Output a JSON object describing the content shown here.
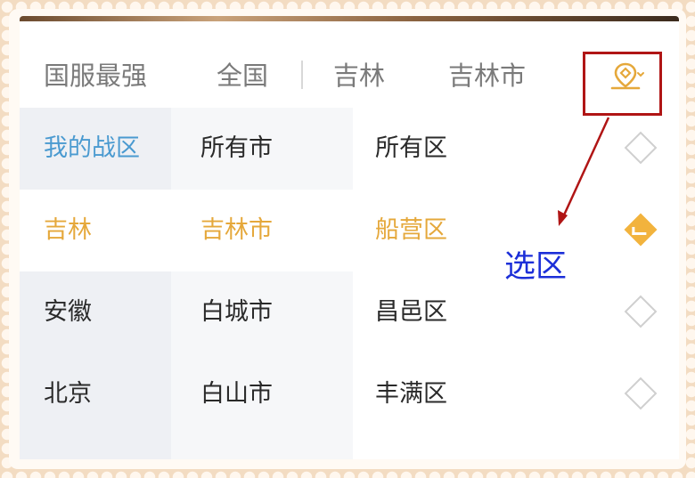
{
  "header": {
    "tabs": [
      {
        "label": "国服最强"
      },
      {
        "label": "全国"
      },
      {
        "label": "吉林"
      },
      {
        "label": "吉林市"
      }
    ]
  },
  "columns": {
    "province": [
      {
        "label": "我的战区",
        "state": "accent-blue"
      },
      {
        "label": "吉林",
        "state": "selected"
      },
      {
        "label": "安徽",
        "state": "normal"
      },
      {
        "label": "北京",
        "state": "normal"
      }
    ],
    "city": [
      {
        "label": "所有市",
        "state": "normal"
      },
      {
        "label": "吉林市",
        "state": "selected"
      },
      {
        "label": "白城市",
        "state": "normal"
      },
      {
        "label": "白山市",
        "state": "normal"
      }
    ],
    "district": [
      {
        "label": "所有区",
        "checked": false
      },
      {
        "label": "船营区",
        "checked": true
      },
      {
        "label": "昌邑区",
        "checked": false
      },
      {
        "label": "丰满区",
        "checked": false
      }
    ]
  },
  "annotation": {
    "label": "选区",
    "box_color": "#b01515",
    "arrow_color": "#b01515",
    "label_color": "#1c2fd8"
  },
  "icons": {
    "location": "location-pin-icon",
    "check": "check-diamond-icon",
    "uncheck": "empty-diamond-icon"
  },
  "colors": {
    "accent_gold": "#e5a83b",
    "accent_blue": "#4a9ad0",
    "text_gray": "#7a7a7a"
  }
}
